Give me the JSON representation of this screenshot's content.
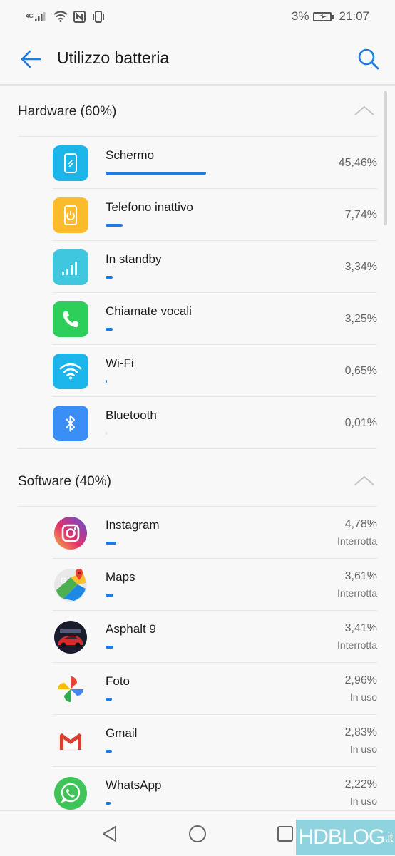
{
  "status": {
    "network_label": "4G",
    "battery_percent": "3%",
    "time": "21:07"
  },
  "header": {
    "title": "Utilizzo batteria",
    "back_icon": "arrow-left-icon",
    "search_icon": "search-icon"
  },
  "hardware": {
    "title": "Hardware (60%)",
    "items": [
      {
        "label": "Schermo",
        "percent": "45,46%",
        "fraction": 0.4546,
        "icon": "phone-screen-icon",
        "color": "#1bb5ea"
      },
      {
        "label": "Telefono inattivo",
        "percent": "7,74%",
        "fraction": 0.0774,
        "icon": "phone-power-icon",
        "color": "#fbbb2a"
      },
      {
        "label": "In standby",
        "percent": "3,34%",
        "fraction": 0.0334,
        "icon": "signal-bars-icon",
        "color": "#3fc7e0"
      },
      {
        "label": "Chiamate vocali",
        "percent": "3,25%",
        "fraction": 0.0325,
        "icon": "phone-call-icon",
        "color": "#2dce5a"
      },
      {
        "label": "Wi-Fi",
        "percent": "0,65%",
        "fraction": 0.0065,
        "icon": "wifi-icon",
        "color": "#1bb5ea"
      },
      {
        "label": "Bluetooth",
        "percent": "0,01%",
        "fraction": 0.0001,
        "icon": "bluetooth-icon",
        "color": "#3a8ef6"
      }
    ]
  },
  "software": {
    "title": "Software (40%)",
    "items": [
      {
        "label": "Instagram",
        "percent": "4,78%",
        "status": "Interrotta",
        "fraction": 0.0478,
        "icon": "instagram-icon"
      },
      {
        "label": "Maps",
        "percent": "3,61%",
        "status": "Interrotta",
        "fraction": 0.0361,
        "icon": "maps-icon"
      },
      {
        "label": "Asphalt 9",
        "percent": "3,41%",
        "status": "Interrotta",
        "fraction": 0.0341,
        "icon": "asphalt-icon"
      },
      {
        "label": "Foto",
        "percent": "2,96%",
        "status": "In uso",
        "fraction": 0.0296,
        "icon": "photos-icon"
      },
      {
        "label": "Gmail",
        "percent": "2,83%",
        "status": "In uso",
        "fraction": 0.0283,
        "icon": "gmail-icon"
      },
      {
        "label": "WhatsApp",
        "percent": "2,22%",
        "status": "In uso",
        "fraction": 0.0222,
        "icon": "whatsapp-icon"
      }
    ]
  },
  "watermark": {
    "brand": "HDBLOG",
    "tld": ".it"
  },
  "colors": {
    "accent": "#1c7ce0",
    "background": "#f8f8f8"
  }
}
